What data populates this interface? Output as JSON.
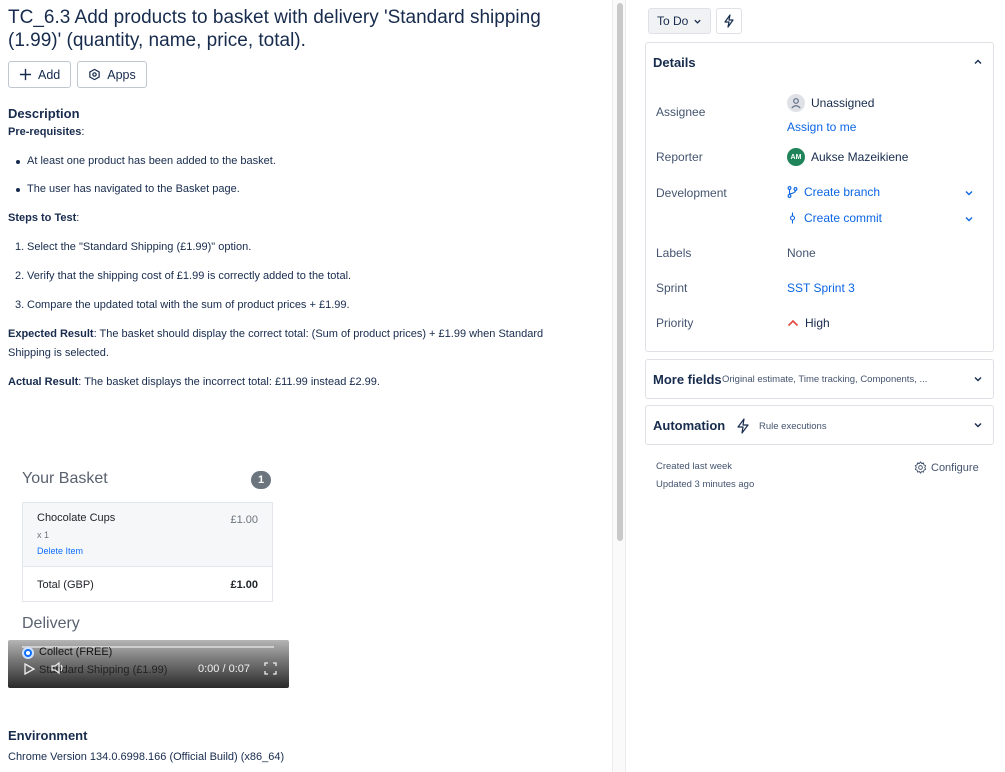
{
  "issue": {
    "title": "TC_6.3 Add products to basket with delivery 'Standard shipping (1.99)' (quantity, name, price, total)."
  },
  "actions": {
    "add_label": "Add",
    "apps_label": "Apps"
  },
  "description": {
    "heading": "Description",
    "prereq_label": "Pre-requisites",
    "prereq_items": [
      "At least one product has been added to the basket.",
      "The user has navigated to the Basket page."
    ],
    "steps_label": "Steps to Test",
    "steps": [
      "Select the \"Standard Shipping (£1.99)\" option.",
      "Verify that the shipping cost of £1.99 is correctly added to the total.",
      "Compare the updated total with the sum of product prices + £1.99."
    ],
    "step_numbers": [
      "1.",
      "2.",
      "3."
    ],
    "expected_label": "Expected Result",
    "expected_text_1": ": The basket should display the correct total: (Sum of product prices) + £1.99 when Standard",
    "expected_text_2": "Shipping is selected.",
    "actual_label": "Actual Result",
    "actual_text": ": The basket displays the incorrect total: £11.99 instead £2.99.",
    "colon": ":"
  },
  "basket": {
    "title": "Your Basket",
    "count": "1",
    "item_name": "Chocolate Cups",
    "item_qty": "x 1",
    "item_delete": "Delete Item",
    "item_price": "£1.00",
    "total_label": "Total (GBP)",
    "total_value": "£1.00",
    "delivery_heading": "Delivery",
    "option_collect": "Collect (FREE)",
    "option_standard": "Standard Shipping (£1.99)",
    "video_time": "0:00 / 0:07"
  },
  "environment": {
    "heading": "Environment",
    "value": "Chrome Version 134.0.6998.166 (Official Build) (x86_64)"
  },
  "sidebar": {
    "status": "To Do",
    "details_heading": "Details",
    "assignee_label": "Assignee",
    "assignee_value": "Unassigned",
    "assign_to_me": "Assign to me",
    "reporter_label": "Reporter",
    "reporter_initials": "AM",
    "reporter_value": "Aukse Mazeikiene",
    "development_label": "Development",
    "create_branch": "Create branch",
    "create_commit": "Create commit",
    "labels_label": "Labels",
    "labels_value": "None",
    "sprint_label": "Sprint",
    "sprint_value": "SST Sprint 3",
    "priority_label": "Priority",
    "priority_value": "High",
    "more_fields_heading": "More fields",
    "more_fields_sub": "Original estimate, Time tracking, Components, ...",
    "automation_heading": "Automation",
    "automation_sub": "Rule executions",
    "created": "Created last week",
    "updated": "Updated 3 minutes ago",
    "configure": "Configure"
  },
  "colors": {
    "link": "#0c66e4",
    "priority_high": "#e2483d",
    "reporter_avatar": "#1f845a",
    "basket_badge": "#6c757d"
  }
}
